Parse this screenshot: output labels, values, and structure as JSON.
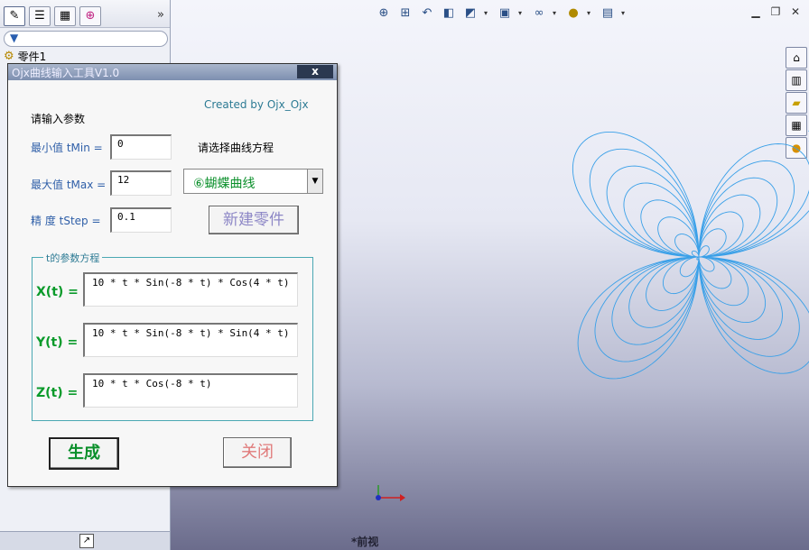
{
  "feature_manager": {
    "root_label": "零件1",
    "more_label": "»"
  },
  "viewport": {
    "view_name": "*前视",
    "curve_color": "#3aa0e8"
  },
  "dialog": {
    "title": "Ojx曲线输入工具V1.0",
    "close_label": "x",
    "credit": "Created by Ojx_Ojx",
    "prompt": "请输入参数",
    "tmin_label": "最小值 tMin =",
    "tmin_value": "0",
    "tmax_label": "最大值 tMax =",
    "tmax_value": "12",
    "tstep_label": "精 度 tStep =",
    "tstep_value": "0.1",
    "select_prompt": "请选择曲线方程",
    "curve_selected": "⑥蝴蝶曲线",
    "new_part_label": "新建零件",
    "group_title": "t的参数方程",
    "x_label": "X(t) =",
    "x_expr": "10 * t * Sin(-8 * t) * Cos(4 * t)",
    "y_label": "Y(t) =",
    "y_expr": "10 * t * Sin(-8 * t) * Sin(4 * t)",
    "z_label": "Z(t) =",
    "z_expr": "10 * t * Cos(-8 * t)",
    "generate_label": "生成",
    "close_button_label": "关闭"
  }
}
